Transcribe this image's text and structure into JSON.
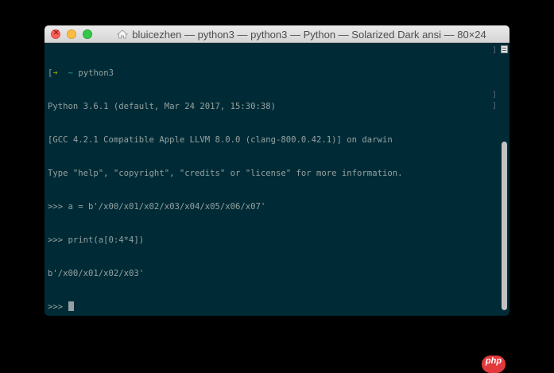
{
  "window": {
    "title": "bluicezhen — python3 — python3 — Python — Solarized Dark ansi — 80×24",
    "title_icon": "home-icon"
  },
  "terminal": {
    "prompt_arrow": "➜",
    "prompt_dir": "~",
    "command": "python3",
    "lines": [
      "Python 3.6.1 (default, Mar 24 2017, 15:30:38)",
      "[GCC 4.2.1 Compatible Apple LLVM 8.0.0 (clang-800.0.42.1)] on darwin",
      "Type \"help\", \"copyright\", \"credits\" or \"license\" for more information.",
      ">>> a = b'/x00/x01/x02/x03/x04/x05/x06/x07'",
      ">>> print(a[0:4*4])",
      "b'/x00/x01/x02/x03'",
      ">>> "
    ],
    "line_mark": "]",
    "line_start_mark": "["
  },
  "watermark": {
    "text": "php"
  },
  "colors": {
    "background": "#002b36",
    "foreground": "#93a1a1",
    "prompt_arrow": "#859900",
    "prompt_dir": "#2aa198"
  }
}
